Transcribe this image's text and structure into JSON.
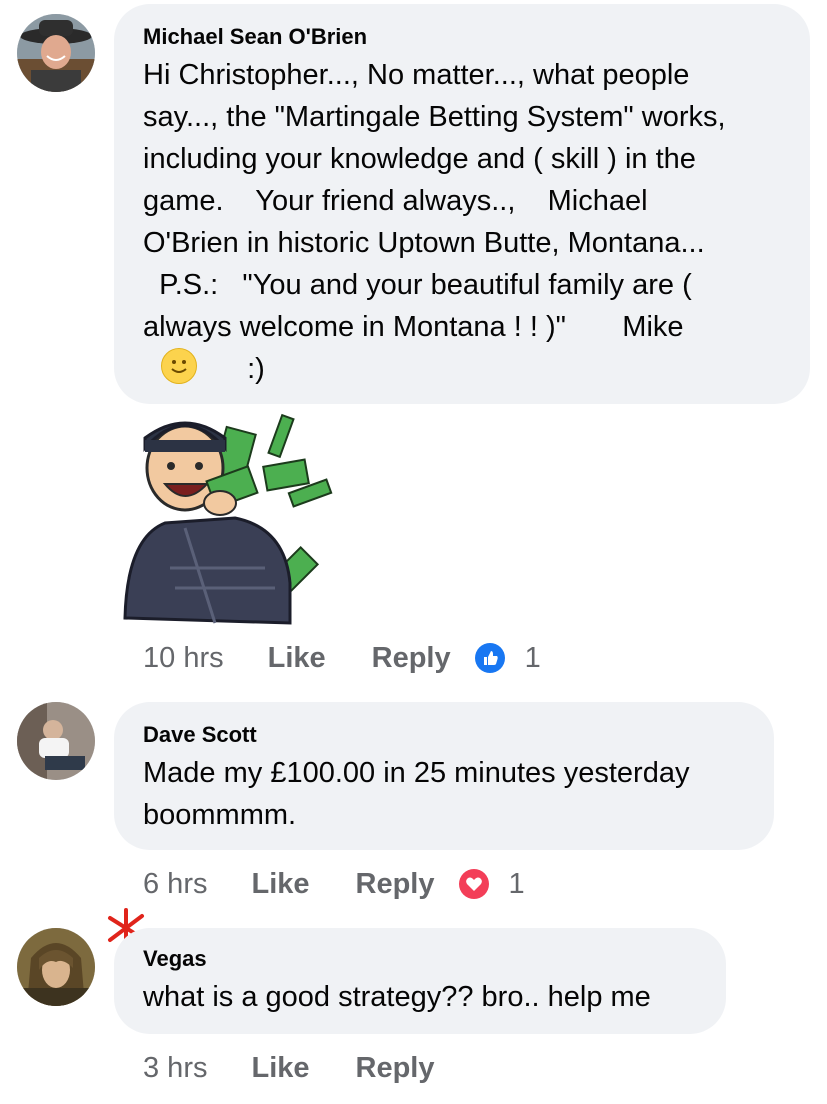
{
  "comments": [
    {
      "author": "Michael Sean O'Brien",
      "text": "Hi Christopher..., No matter..., what people\nsay..., the \"Martingale Betting System\" works,\nincluding your knowledge and ( skill ) in the\ngame.    Your friend always..,    Michael\nO'Brien in historic Uptown Butte, Montana...\n  P.S.:   \"You and your beautiful family are (\nalways welcome in Montana ! ! )\"       Mike",
      "text_tail": ":)",
      "time": "10 hrs",
      "like_label": "Like",
      "reply_label": "Reply",
      "reaction": "like",
      "reaction_count": "1",
      "sticker": "money-sticker"
    },
    {
      "author": "Dave Scott",
      "text": "Made my £100.00 in 25 minutes yesterday\nboommmm.",
      "time": "6 hrs",
      "like_label": "Like",
      "reply_label": "Reply",
      "reaction": "love",
      "reaction_count": "1"
    },
    {
      "author": "Vegas",
      "text": "what is a good strategy?? bro.. help me",
      "time": "3 hrs",
      "like_label": "Like",
      "reply_label": "Reply"
    }
  ],
  "colors": {
    "bubble_bg": "#f0f2f5",
    "muted_text": "#65676b",
    "like_blue": "#1877f2",
    "love_red": "#f33e58",
    "annotation_red": "#e0241b"
  }
}
